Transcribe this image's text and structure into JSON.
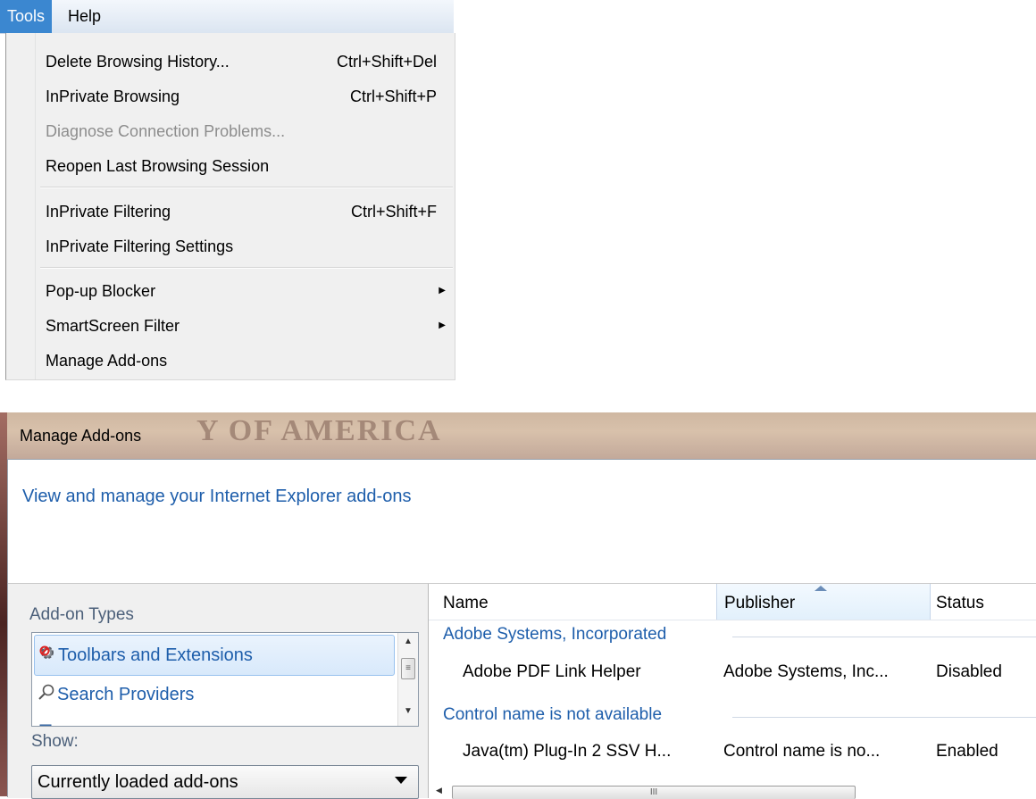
{
  "menubar": {
    "items": [
      {
        "label": "Tools"
      },
      {
        "label": "Help"
      }
    ]
  },
  "tools_menu": {
    "items": [
      {
        "label": "Delete Browsing History...",
        "shortcut": "Ctrl+Shift+Del"
      },
      {
        "label": "InPrivate Browsing",
        "shortcut": "Ctrl+Shift+P"
      },
      {
        "label": "Diagnose Connection Problems...",
        "shortcut": "",
        "disabled": true
      },
      {
        "label": "Reopen Last Browsing Session",
        "shortcut": ""
      },
      {
        "label": "InPrivate Filtering",
        "shortcut": "Ctrl+Shift+F"
      },
      {
        "label": "InPrivate Filtering Settings",
        "shortcut": ""
      },
      {
        "label": "Pop-up Blocker",
        "submenu": true
      },
      {
        "label": "SmartScreen Filter",
        "submenu": true
      },
      {
        "label": "Manage Add-ons"
      }
    ]
  },
  "manage_addons": {
    "title": "Manage Add-ons",
    "background_watermark": "Y OF AMERICA",
    "headline": "View and manage your Internet Explorer add-ons",
    "types_label": "Add-on Types",
    "types": [
      {
        "label": "Toolbars and Extensions",
        "icon": "gear-icon",
        "selected": true
      },
      {
        "label": "Search Providers",
        "icon": "search-icon"
      }
    ],
    "show_label": "Show:",
    "show_value": "Currently loaded add-ons",
    "columns": {
      "name": "Name",
      "publisher": "Publisher",
      "status": "Status"
    },
    "groups": [
      {
        "name": "Adobe Systems, Incorporated",
        "rows": [
          {
            "name": "Adobe PDF Link Helper",
            "publisher": "Adobe Systems, Inc...",
            "status": "Disabled"
          }
        ]
      },
      {
        "name": "Control name is not available",
        "rows": [
          {
            "name": "Java(tm) Plug-In 2 SSV H...",
            "publisher": "Control name is no...",
            "status": "Enabled"
          }
        ]
      }
    ]
  },
  "colors": {
    "menu_highlight": "#3b87d0",
    "link_blue": "#1e5eab",
    "disabled_text": "#8d8d8d"
  }
}
